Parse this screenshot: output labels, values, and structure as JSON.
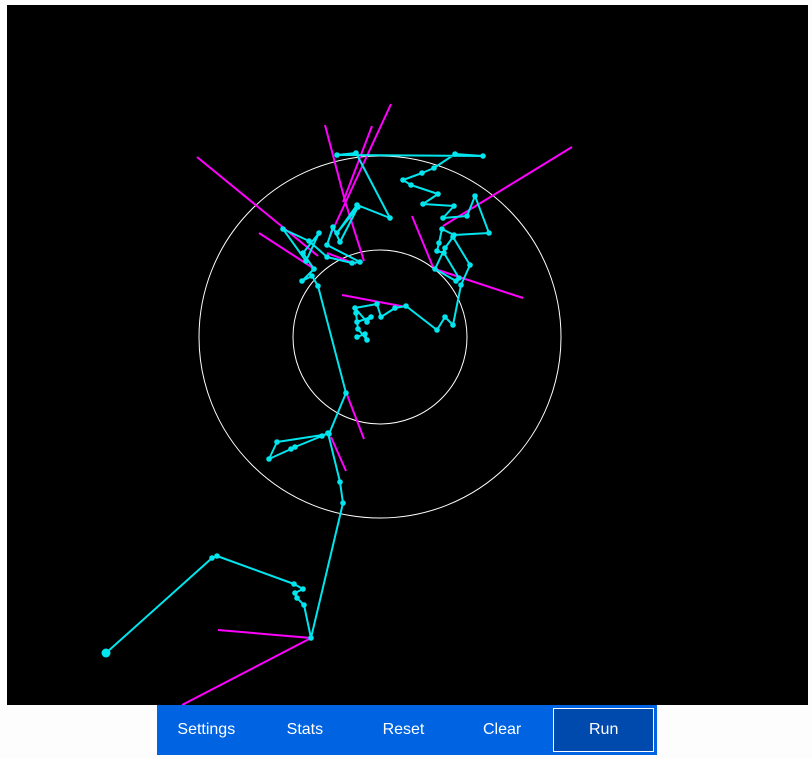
{
  "toolbar": {
    "buttons": [
      {
        "id": "settings",
        "label": "Settings"
      },
      {
        "id": "stats",
        "label": "Stats"
      },
      {
        "id": "reset",
        "label": "Reset"
      },
      {
        "id": "clear",
        "label": "Clear"
      },
      {
        "id": "run",
        "label": "Run",
        "active": true
      }
    ]
  },
  "colors": {
    "background": "#000000",
    "path": "#00ffff",
    "direction_lines": "#ff00ff",
    "rings": "#ffffff",
    "toolbar": "#0063e1",
    "active_button": "#0049ad"
  }
}
